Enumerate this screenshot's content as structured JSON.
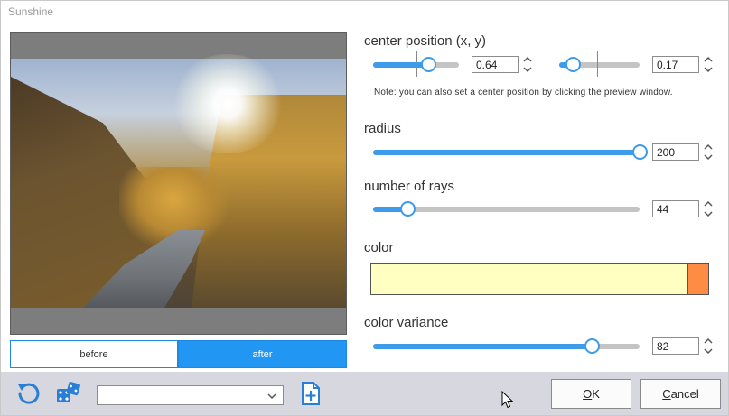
{
  "window": {
    "title": "Sunshine"
  },
  "preview": {
    "toggle": {
      "before_label": "before",
      "after_label": "after",
      "selected": "after"
    }
  },
  "center_position": {
    "label": "center position (x, y)",
    "x": {
      "value": "0.64",
      "level": 0.64
    },
    "y": {
      "value": "0.17",
      "level": 0.17
    },
    "note": "Note: you can also set a center position by clicking the preview window."
  },
  "radius": {
    "label": "radius",
    "value": "200",
    "level": 1.0
  },
  "number_of_rays": {
    "label": "number of rays",
    "value": "44",
    "level": 0.13
  },
  "color": {
    "label": "color",
    "primary": "#ffffc2",
    "accent": "#ff8c42"
  },
  "color_variance": {
    "label": "color variance",
    "value": "82",
    "level": 0.82
  },
  "toolbar": {
    "reset_icon": "reset-icon",
    "random_icon": "dice-icon",
    "preset_value": "",
    "add_preset_icon": "add-preset-icon"
  },
  "buttons": {
    "ok_label": "OK",
    "ok_mnemonic": "O",
    "ok_rest": "K",
    "cancel_mnemonic": "C",
    "cancel_rest": "ancel"
  },
  "colors": {
    "accent": "#2196f3",
    "slider_fill": "#3d9be9",
    "track": "#c4c4c4",
    "bottombar": "#d7d7e0"
  }
}
